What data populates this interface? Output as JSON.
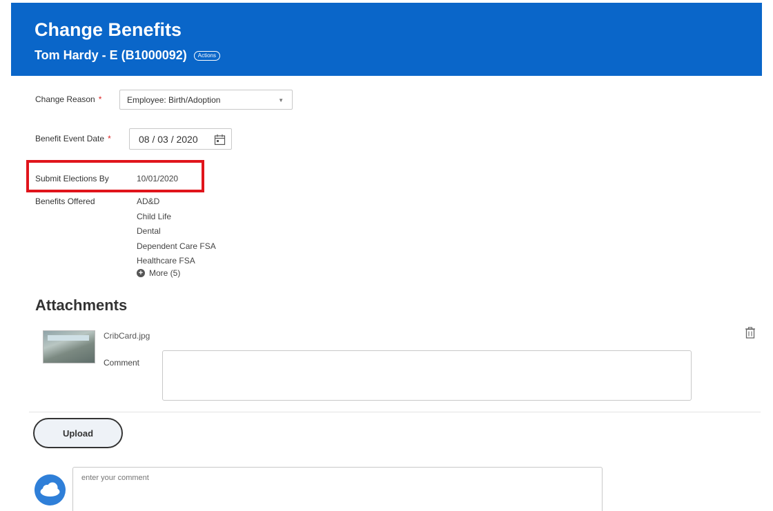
{
  "header": {
    "title": "Change Benefits",
    "subtitle": "Tom Hardy - E (B1000092)",
    "actions_label": "Actions",
    "color": "#0a66c9"
  },
  "form": {
    "change_reason": {
      "label": "Change Reason",
      "value": "Employee: Birth/Adoption",
      "required_mark": "*"
    },
    "event_date": {
      "label": "Benefit Event Date",
      "value": "08 / 03 / 2020",
      "required_mark": "*"
    },
    "submit_by": {
      "label": "Submit Elections By",
      "value": "10/01/2020"
    },
    "benefits": {
      "label": "Benefits Offered",
      "items": [
        "AD&D",
        "Child Life",
        "Dental",
        "Dependent Care FSA",
        "Healthcare FSA"
      ],
      "more_label": "More (5)"
    }
  },
  "attachments": {
    "title": "Attachments",
    "file_name": "CribCard.jpg",
    "comment_label": "Comment",
    "comment_value": "",
    "upload_label": "Upload"
  },
  "comment_box": {
    "placeholder": "enter your comment"
  },
  "icons": {
    "calendar": "calendar-icon",
    "trash": "trash-icon",
    "more": "plus-circle-icon",
    "avatar": "cloud-avatar-icon"
  },
  "highlight_color": "#e0141b"
}
